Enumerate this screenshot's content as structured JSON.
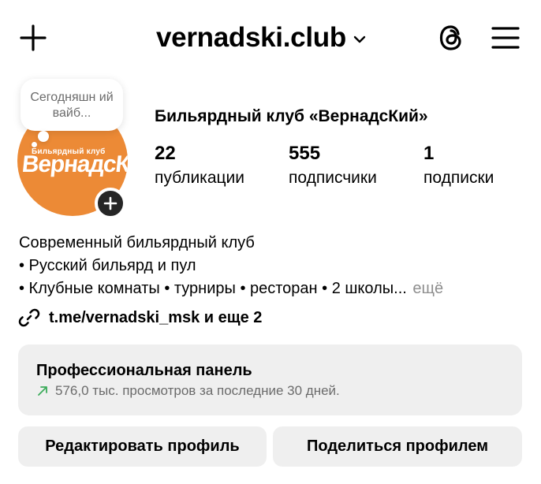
{
  "header": {
    "username": "vernadski.club",
    "icons": {
      "create": "plus-icon",
      "switch_account": "chevron-down-icon",
      "threads": "threads-icon",
      "menu": "hamburger-menu-icon"
    }
  },
  "profile": {
    "note_text": "Сегодняшн ий вайб...",
    "avatar_logo_small": "Бильярдный клуб",
    "avatar_logo_big": "ВернадсКий",
    "brand_color": "#ec8a36",
    "display_name": "Бильярдный клуб «ВернадсКий»",
    "stats": [
      {
        "value": "22",
        "label": "публикации"
      },
      {
        "value": "555",
        "label": "подписчики"
      },
      {
        "value": "1",
        "label": "подписки"
      }
    ],
    "bio_lines": [
      "Современный бильярдный клуб",
      "• Русский бильярд и пул",
      "• Клубные комнаты • турниры • ресторан • 2 школы..."
    ],
    "bio_more": "ещё",
    "link": "t.me/vernadski_msk и еще 2",
    "link_icon": "link-icon"
  },
  "professional_panel": {
    "title": "Профессиональная панель",
    "subtitle": "576,0 тыс. просмотров за последние 30 дней.",
    "trend_icon": "trend-up-arrow-icon",
    "trend_color": "#3bab5a"
  },
  "actions": {
    "edit": "Редактировать профиль",
    "share": "Поделиться профилем"
  }
}
